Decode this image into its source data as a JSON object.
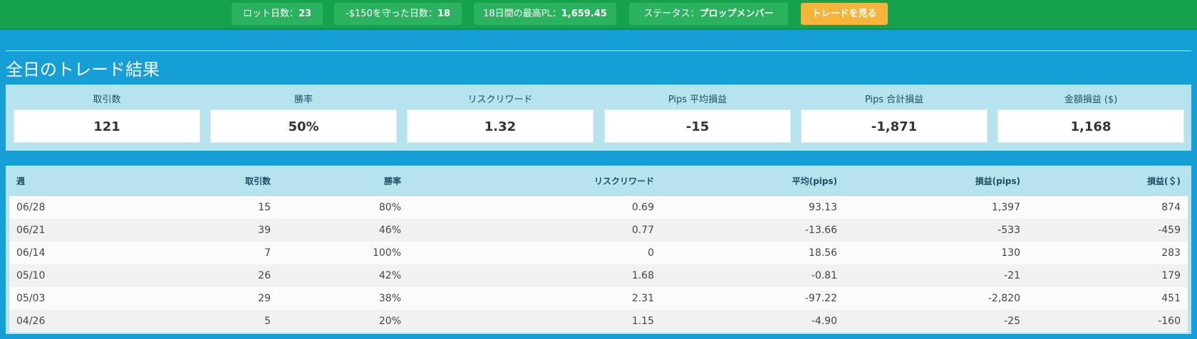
{
  "topbar": {
    "lot_days_label": "ロット日数：",
    "lot_days_value": "23",
    "protected_days_label": "-$150を守った日数：",
    "protected_days_value": "18",
    "best_pl_label": "18日間の最高PL：",
    "best_pl_value": "1,659.45",
    "status_label": "ステータス：",
    "status_value": "プロップメンバー",
    "view_trades_label": "トレードを見る",
    "bar_color": "#16a24c",
    "button_color": "#f6b53a"
  },
  "section": {
    "title": "全日のトレード結果"
  },
  "stats": [
    {
      "label": "取引数",
      "value": "121"
    },
    {
      "label": "勝率",
      "value": "50%"
    },
    {
      "label": "リスクリワード",
      "value": "1.32"
    },
    {
      "label": "Pips 平均損益",
      "value": "-15"
    },
    {
      "label": "Pips 合計損益",
      "value": "-1,871"
    },
    {
      "label": "金額損益 ($)",
      "value": "1,168"
    }
  ],
  "table": {
    "headers": [
      "週",
      "取引数",
      "勝率",
      "リスクリワード",
      "平均(pips)",
      "損益(pips)",
      "損益(＄)"
    ],
    "rows": [
      [
        "06/28",
        "15",
        "80%",
        "0.69",
        "93.13",
        "1,397",
        "874"
      ],
      [
        "06/21",
        "39",
        "46%",
        "0.77",
        "-13.66",
        "-533",
        "-459"
      ],
      [
        "06/14",
        "7",
        "100%",
        "0",
        "18.56",
        "130",
        "283"
      ],
      [
        "05/10",
        "26",
        "42%",
        "1.68",
        "-0.81",
        "-21",
        "179"
      ],
      [
        "05/03",
        "29",
        "38%",
        "2.31",
        "-97.22",
        "-2,820",
        "451"
      ],
      [
        "04/26",
        "5",
        "20%",
        "1.15",
        "-4.90",
        "-25",
        "-160"
      ]
    ]
  },
  "colors": {
    "background": "#159fd6",
    "panel": "#b7e3ef"
  }
}
